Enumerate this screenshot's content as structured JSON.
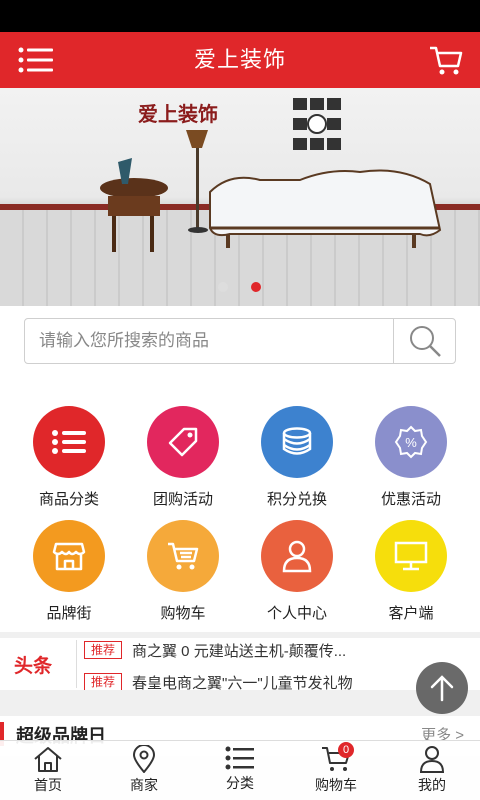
{
  "header": {
    "title": "爱上装饰"
  },
  "banner": {
    "brand_text": "爱上装饰",
    "slide_count": 2,
    "active_slide": 2
  },
  "search": {
    "placeholder": "请输入您所搜索的商品"
  },
  "categories": [
    {
      "label": "商品分类",
      "color": "#e0272a",
      "icon": "list-icon"
    },
    {
      "label": "团购活动",
      "color": "#e2275e",
      "icon": "tag-icon"
    },
    {
      "label": "积分兑换",
      "color": "#3d82cf",
      "icon": "coins-icon"
    },
    {
      "label": "优惠活动",
      "color": "#8a8fcc",
      "icon": "discount-icon"
    },
    {
      "label": "品牌街",
      "color": "#f39a1f",
      "icon": "shop-icon"
    },
    {
      "label": "购物车",
      "color": "#f5a93a",
      "icon": "cart-icon"
    },
    {
      "label": "个人中心",
      "color": "#e9613e",
      "icon": "user-icon"
    },
    {
      "label": "客户端",
      "color": "#f6de0c",
      "icon": "monitor-icon"
    }
  ],
  "headline": {
    "tag": "头条",
    "items": [
      {
        "badge": "推荐",
        "text": "商之翼 0 元建站送主机-颠覆传..."
      },
      {
        "badge": "推荐",
        "text": "春皇电商之翼\"六一\"儿童节发礼物"
      }
    ]
  },
  "brand_section": {
    "title": "超级品牌日",
    "more": "更多 >"
  },
  "tabbar": [
    {
      "label": "首页",
      "icon": "home-icon"
    },
    {
      "label": "商家",
      "icon": "location-icon"
    },
    {
      "label": "分类",
      "icon": "list-icon"
    },
    {
      "label": "购物车",
      "icon": "cart-icon",
      "badge": "0"
    },
    {
      "label": "我的",
      "icon": "user-icon"
    }
  ]
}
